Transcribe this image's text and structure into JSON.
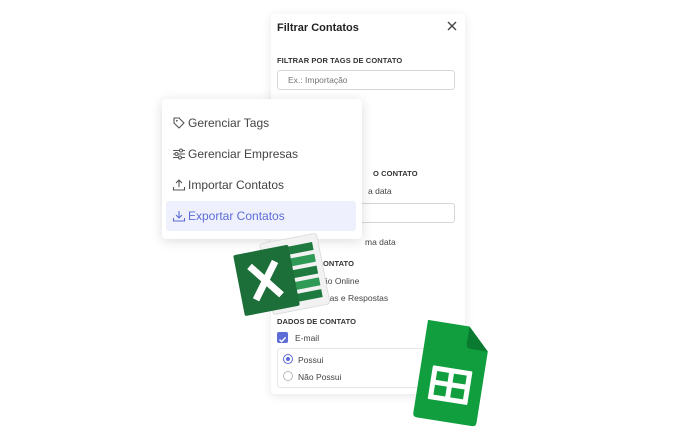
{
  "filter_panel": {
    "title": "Filtrar Contatos",
    "tags_section": {
      "label": "FILTRAR POR TAGS DE CONTATO",
      "placeholder": "Ex.: Importação"
    },
    "date_section": {
      "label_partial": "O CONTATO",
      "option1_partial": "a data",
      "option2_partial": "ma data"
    },
    "source_section": {
      "label_partial": "ONTATO",
      "option1_partial": "ão Online",
      "option2_partial": "esquisas e Respostas"
    },
    "contact_data": {
      "label": "DADOS DE CONTATO",
      "email_label": "E-mail",
      "has_label": "Possui",
      "not_has_label": "Não Possui"
    }
  },
  "menu": {
    "items": [
      {
        "label": "Gerenciar Tags",
        "icon": "tag-icon"
      },
      {
        "label": "Gerenciar Empresas",
        "icon": "sliders-icon"
      },
      {
        "label": "Importar Contatos",
        "icon": "upload-icon"
      },
      {
        "label": "Exportar Contatos",
        "icon": "download-icon",
        "active": true
      }
    ]
  },
  "colors": {
    "accent": "#5d6cd6",
    "excel_green": "#1e7a3e",
    "sheets_green": "#109e3f"
  }
}
